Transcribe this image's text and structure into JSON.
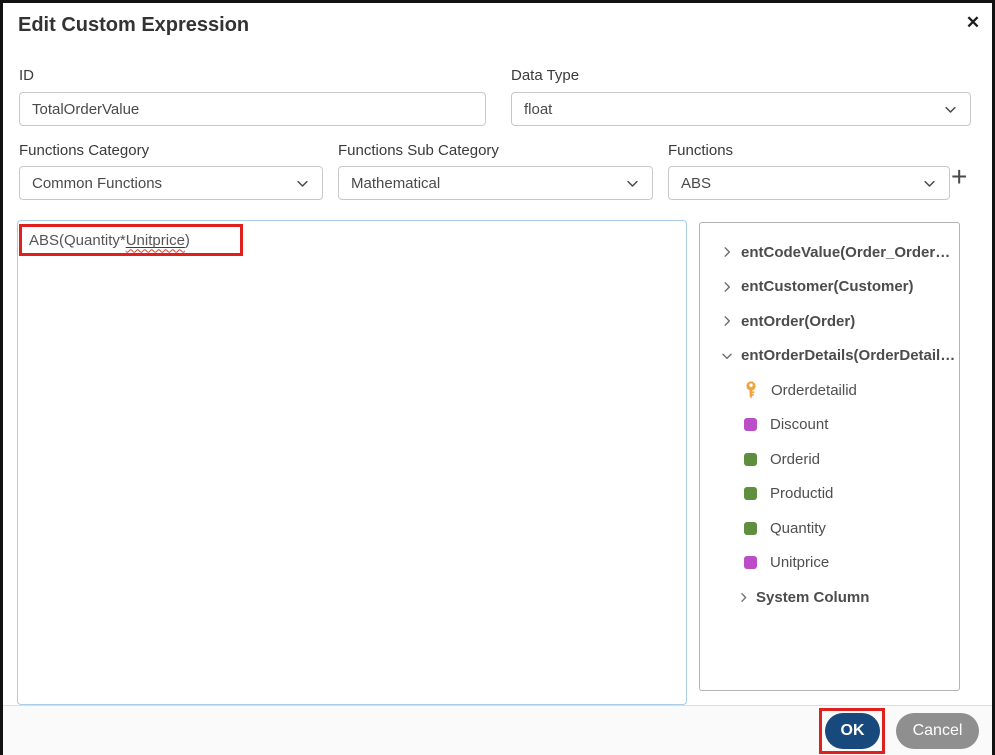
{
  "dialog": {
    "title": "Edit Custom Expression",
    "close_icon": "✕"
  },
  "fields": {
    "id": {
      "label": "ID",
      "value": "TotalOrderValue"
    },
    "data_type": {
      "label": "Data Type",
      "value": "float"
    },
    "functions_category": {
      "label": "Functions Category",
      "value": "Common Functions"
    },
    "functions_sub_category": {
      "label": "Functions Sub Category",
      "value": "Mathematical"
    },
    "functions": {
      "label": "Functions",
      "value": "ABS"
    },
    "add_function_icon": "+"
  },
  "expression": {
    "full_text": "ABS(Quantity*Unitprice)",
    "prefix": "ABS(Quantity*",
    "underlined": "Unitprice",
    "suffix": ")"
  },
  "tree": {
    "items": [
      {
        "kind": "entity",
        "state": "collapsed",
        "label": "entCodeValue(Order_Order…"
      },
      {
        "kind": "entity",
        "state": "collapsed",
        "label": "entCustomer(Customer)"
      },
      {
        "kind": "entity",
        "state": "collapsed",
        "label": "entOrder(Order)"
      },
      {
        "kind": "entity",
        "state": "expanded",
        "label": "entOrderDetails(OrderDetail…"
      },
      {
        "kind": "field",
        "icon": "primary-key",
        "label": "Orderdetailid"
      },
      {
        "kind": "field",
        "icon": "column-magenta",
        "label": "Discount"
      },
      {
        "kind": "field",
        "icon": "column-green",
        "label": "Orderid"
      },
      {
        "kind": "field",
        "icon": "column-green",
        "label": "Productid"
      },
      {
        "kind": "field",
        "icon": "column-green",
        "label": "Quantity"
      },
      {
        "kind": "field",
        "icon": "column-magenta",
        "label": "Unitprice"
      },
      {
        "kind": "entity",
        "state": "collapsed",
        "label": "System Column"
      }
    ]
  },
  "footer": {
    "ok_label": "OK",
    "cancel_label": "Cancel"
  },
  "colors": {
    "annotation_red": "#e0201f",
    "ok_button_blue": "#17497d",
    "cancel_button_gray": "#8f8f8f",
    "key_orange": "#f2a33c",
    "column_green": "#5d8f3f",
    "column_magenta": "#bb4dc7",
    "expression_border_blue": "#a9cde9"
  }
}
